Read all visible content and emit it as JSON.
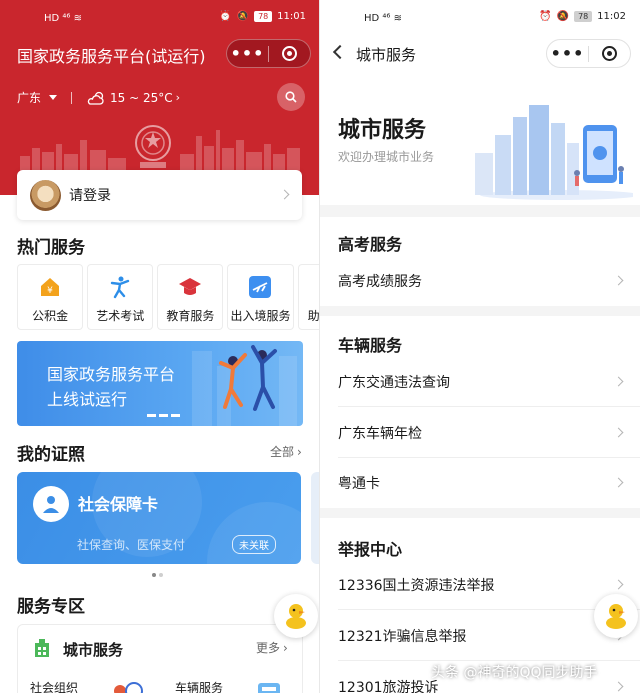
{
  "left": {
    "status": {
      "network": "HD ⁴⁶ ≋",
      "battery": "78",
      "time": "11:01"
    },
    "title": "国家政务服务平台(试运行)",
    "capsule": {
      "more": "•••"
    },
    "location": "广东",
    "weather": "15 ~ 25°C",
    "login": {
      "label": "请登录"
    },
    "hot_title": "热门服务",
    "hot_services": [
      {
        "label": "公积金",
        "icon": "housing-fund-icon",
        "color": "#f3a21c"
      },
      {
        "label": "艺术考试",
        "icon": "art-exam-icon",
        "color": "#2d8ee8"
      },
      {
        "label": "教育服务",
        "icon": "education-icon",
        "color": "#d9343c"
      },
      {
        "label": "出入境服务",
        "icon": "exit-entry-icon",
        "color": "#3d8ff0"
      },
      {
        "label": "助",
        "icon": "partial-icon",
        "color": "#999999"
      }
    ],
    "banner": {
      "line1": "国家政务服务平台",
      "line2": "上线试运行"
    },
    "cert_title": "我的证照",
    "cert_more": "全部",
    "cert_card": {
      "name": "社会保障卡",
      "desc": "社保查询、医保支付",
      "badge": "未关联"
    },
    "zone_title": "服务专区",
    "zone_card": {
      "title": "城市服务",
      "more": "更多",
      "item1": "社会组织",
      "item2": "车辆服务"
    }
  },
  "right": {
    "status": {
      "network": "HD ⁴⁶ ≋",
      "battery": "78",
      "time": "11:02"
    },
    "nav_title": "城市服务",
    "capsule": {
      "more": "•••"
    },
    "big_title": "城市服务",
    "subtitle": "欢迎办理城市业务",
    "sections": [
      {
        "title": "高考服务",
        "items": [
          "高考成绩服务"
        ]
      },
      {
        "title": "车辆服务",
        "items": [
          "广东交通违法查询",
          "广东车辆年检",
          "粤通卡"
        ]
      },
      {
        "title": "举报中心",
        "items": [
          "12336国土资源违法举报",
          "12321诈骗信息举报",
          "12301旅游投诉"
        ]
      }
    ]
  },
  "watermark": "头条 @神奇的QQ同步助手",
  "colors": {
    "brand_red": "#c9262d",
    "brand_blue": "#3b8ee6"
  }
}
